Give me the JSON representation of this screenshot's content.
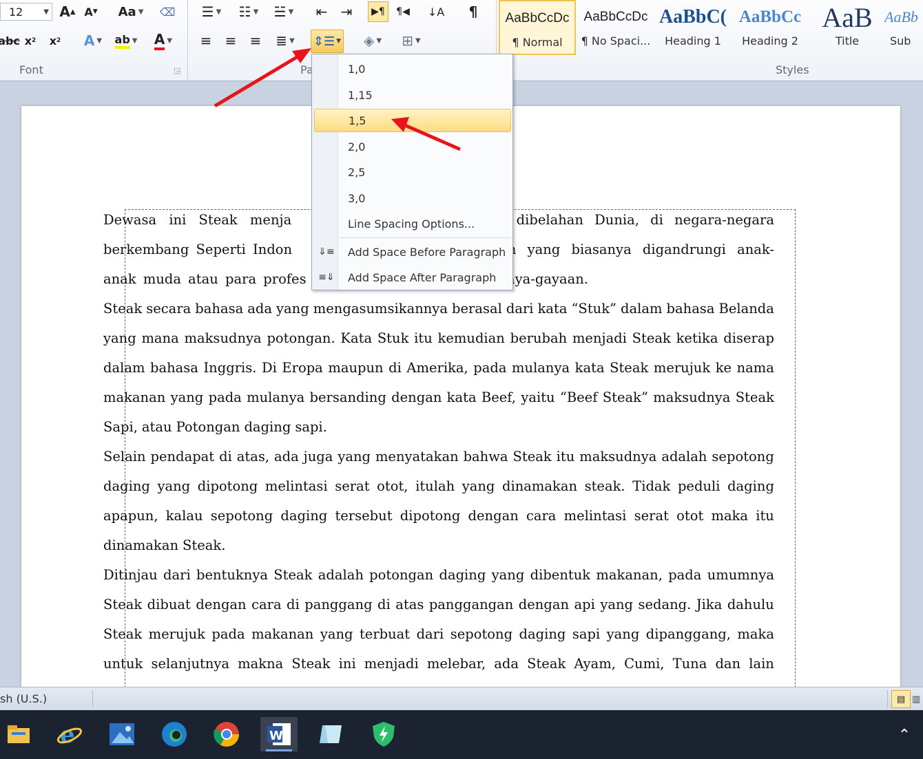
{
  "ribbon": {
    "font_size": "12",
    "font_group_label": "Font",
    "paragraph_group_label": "Paragraph",
    "styles_group_label": "Styles",
    "change_case_label": "Aa",
    "styles": [
      {
        "sample": "AaBbCcDc",
        "name": "¶ Normal",
        "active": true
      },
      {
        "sample": "AaBbCcDc",
        "name": "¶ No Spaci..."
      },
      {
        "sample": "AaBbC(",
        "name": "Heading 1"
      },
      {
        "sample": "AaBbCc",
        "name": "Heading 2"
      },
      {
        "sample": "AaB",
        "name": "Title"
      },
      {
        "sample": "AaBb",
        "name": "Sub"
      }
    ]
  },
  "line_spacing_menu": {
    "options": [
      "1,0",
      "1,15",
      "1,5",
      "2,0",
      "2,5",
      "3,0"
    ],
    "selected": "1,5",
    "options_label": "Line Spacing Options...",
    "add_before_label": "Add Space Before Paragraph",
    "add_after_label": "Add Space After Paragraph"
  },
  "document": {
    "lines": [
      "Dewasa ini Steak menja",
      "berkembang Seperti Indon",
      "anak muda atau para profes",
      "Steak secara bahasa ada yang mengasumsikannya berasal dari kata “Stuk” dalam bahasa Belanda",
      "yang mana maksudnya potongan. Kata Stuk itu kemudian berubah menjadi Steak ketika diserap",
      "dalam bahasa Inggris. Di Eropa maupun di  Amerika, pada mulanya kata Steak merujuk ke nama",
      "makanan yang pada mulanya bersanding dengan kata Beef, yaitu “Beef Steak” maksudnya Steak",
      "Sapi, atau Potongan daging sapi.",
      "Selain pendapat di atas, ada juga yang menyatakan bahwa Steak itu maksudnya adalah sepotong",
      "daging yang dipotong melintasi serat otot, itulah yang dinamakan steak. Tidak peduli daging",
      "apapun, kalau sepotong daging tersebut dipotong dengan cara melintasi serat otot maka itu",
      "dinamakan Steak.",
      "Ditinjau dari bentuknya Steak adalah potongan daging yang dibentuk makanan, pada umumnya",
      "Steak dibuat dengan cara di panggang di atas panggangan dengan api yang sedang. Jika dahulu",
      "Steak merujuk pada makanan yang terbuat dari sepotong daging sapi yang dipanggang, maka",
      "untuk selanjutnya makna Steak ini menjadi melebar, ada Steak Ayam, Cumi, Tuna dan lain"
    ],
    "line1_right": "ng dibelahan Dunia, di negara-negara",
    "line2_right": "akanan yang biasanya digandrungi anak-",
    "line3_right": "gaya-gayaan."
  },
  "status_bar": {
    "language": "sh (U.S.)"
  },
  "taskbar": {
    "apps": [
      "file-explorer",
      "internet-explorer",
      "photos",
      "edge",
      "chrome",
      "word",
      "app-6",
      "security"
    ]
  },
  "colors": {
    "accent_arrow": "#e8141c",
    "highlight": "#fbdc80",
    "taskbar_bg": "#1c2330"
  }
}
